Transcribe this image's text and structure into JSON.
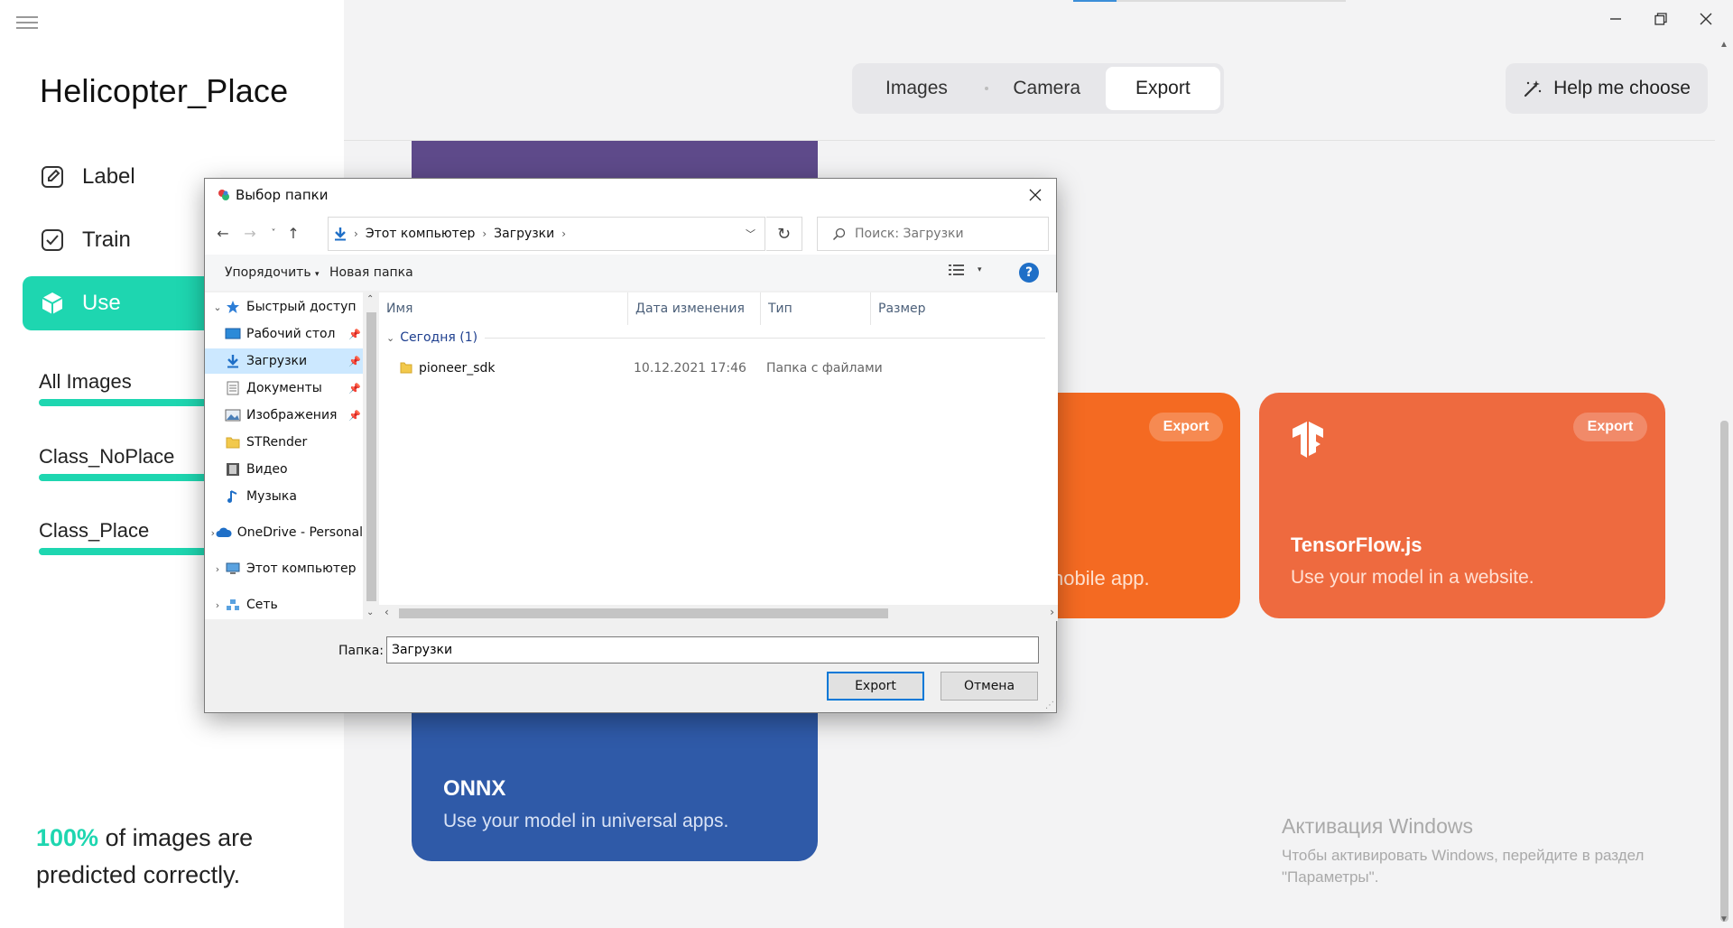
{
  "sidebar": {
    "project_title": "Helicopter_Place",
    "nav": [
      {
        "label": "Label",
        "icon": "edit-icon"
      },
      {
        "label": "Train",
        "icon": "checkbox-icon"
      },
      {
        "label": "Use",
        "icon": "cube-icon"
      }
    ],
    "classes": [
      "All Images",
      "Class_NoPlace",
      "Class_Place"
    ],
    "accuracy_value": "100%",
    "accuracy_text": " of images are predicted correctly."
  },
  "header": {
    "tabs": [
      "Images",
      "Camera",
      "Export"
    ],
    "active_tab": "Export",
    "help_label": "Help me choose",
    "progress_fraction": 0.16
  },
  "cards": {
    "onnx_title": "ONNX",
    "onnx_desc": "Use your model in universal apps.",
    "mobile_desc_partial": "nobile app.",
    "tf_title": "TensorFlow.js",
    "tf_desc": "Use your model in a website.",
    "export_chip": "Export"
  },
  "watermark": {
    "title": "Активация Windows",
    "subtitle": "Чтобы активировать Windows, перейдите в раздел \"Параметры\"."
  },
  "dialog": {
    "title": "Выбор папки",
    "address": [
      "Этот компьютер",
      "Загрузки"
    ],
    "search_placeholder": "Поиск: Загрузки",
    "organize_label": "Упорядочить",
    "new_folder_label": "Новая папка",
    "tree": [
      {
        "label": "Быстрый доступ",
        "icon": "star-icon",
        "level": 0,
        "expanded": true
      },
      {
        "label": "Рабочий стол",
        "icon": "desktop-icon",
        "level": 1,
        "pinned": true
      },
      {
        "label": "Загрузки",
        "icon": "downloads-icon",
        "level": 1,
        "pinned": true,
        "selected": true
      },
      {
        "label": "Документы",
        "icon": "documents-icon",
        "level": 1,
        "pinned": true
      },
      {
        "label": "Изображения",
        "icon": "pictures-icon",
        "level": 1,
        "pinned": true
      },
      {
        "label": "STRender",
        "icon": "folder-icon",
        "level": 1
      },
      {
        "label": "Видео",
        "icon": "video-icon",
        "level": 1
      },
      {
        "label": "Музыка",
        "icon": "music-icon",
        "level": 1
      },
      {
        "label": "OneDrive - Personal",
        "icon": "cloud-icon",
        "level": 0
      },
      {
        "label": "Этот компьютер",
        "icon": "computer-icon",
        "level": 0
      },
      {
        "label": "Сеть",
        "icon": "network-icon",
        "level": 0
      }
    ],
    "columns": [
      "Имя",
      "Дата изменения",
      "Тип",
      "Размер"
    ],
    "group_label": "Сегодня (1)",
    "files": [
      {
        "name": "pioneer_sdk",
        "date": "10.12.2021 17:46",
        "type": "Папка с файлами"
      }
    ],
    "folder_label": "Папка:",
    "folder_value": "Загрузки",
    "ok_label": "Export",
    "cancel_label": "Отмена"
  }
}
